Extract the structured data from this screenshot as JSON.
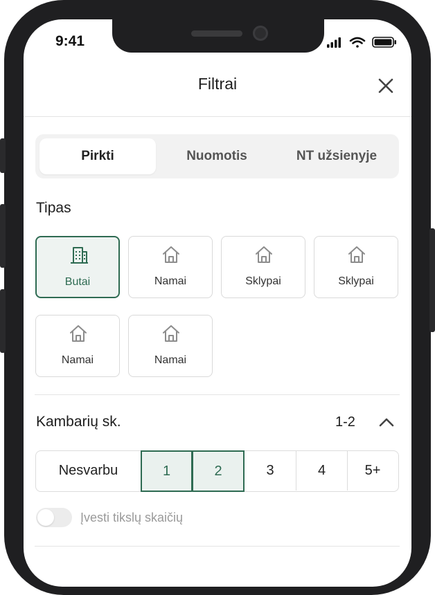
{
  "status_bar": {
    "time": "9:41",
    "icons": [
      "signal-icon",
      "wifi-icon",
      "battery-icon"
    ]
  },
  "header": {
    "title": "Filtrai",
    "close_icon": "close-icon"
  },
  "tabs": [
    {
      "label": "Pirkti",
      "active": true
    },
    {
      "label": "Nuomotis",
      "active": false
    },
    {
      "label": "NT užsienyje",
      "active": false
    }
  ],
  "type_section": {
    "label": "Tipas",
    "options": [
      {
        "label": "Butai",
        "icon": "building-icon",
        "selected": true
      },
      {
        "label": "Namai",
        "icon": "house-icon",
        "selected": false
      },
      {
        "label": "Sklypai",
        "icon": "house-icon",
        "selected": false
      },
      {
        "label": "Sklypai",
        "icon": "house-icon",
        "selected": false
      },
      {
        "label": "Namai",
        "icon": "house-icon",
        "selected": false
      },
      {
        "label": "Namai",
        "icon": "house-icon",
        "selected": false
      }
    ]
  },
  "rooms_section": {
    "label": "Kambarių sk.",
    "value": "1-2",
    "options": [
      {
        "label": "Nesvarbu",
        "selected": false
      },
      {
        "label": "1",
        "selected": true
      },
      {
        "label": "2",
        "selected": true
      },
      {
        "label": "3",
        "selected": false
      },
      {
        "label": "4",
        "selected": false
      },
      {
        "label": "5+",
        "selected": false
      }
    ],
    "exact_toggle": {
      "label": "Įvesti tikslų skaičių",
      "on": false
    }
  },
  "colors": {
    "accent": "#2e6b52",
    "accent_bg": "#eef3f1",
    "border": "#d9d9d9",
    "frame": "#1f1f21"
  }
}
